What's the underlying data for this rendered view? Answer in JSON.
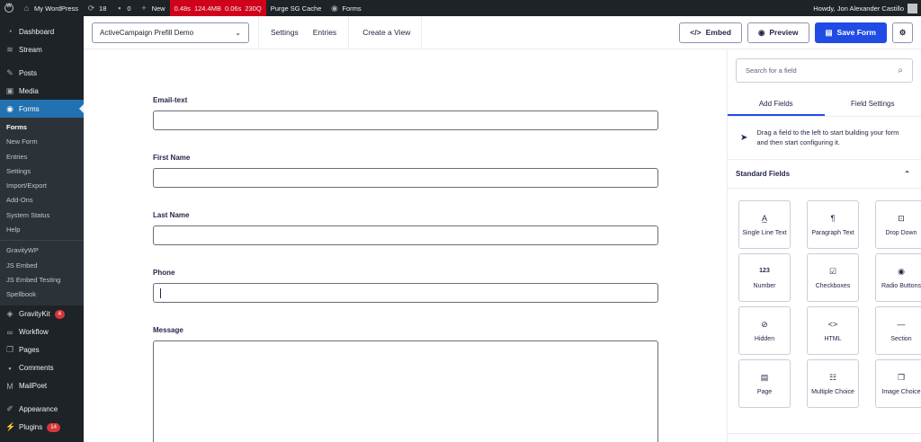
{
  "adminbar": {
    "site_name": "My WordPress",
    "updates_count": "18",
    "comments_count": "0",
    "new_label": "New",
    "perf": [
      "0.48s",
      "124.4MB",
      "0.06s",
      "230Q"
    ],
    "purge_label": "Purge SG Cache",
    "forms_label": "Forms",
    "howdy": "Howdy, Jon Alexander Castillo"
  },
  "sidebar": {
    "dashboard": "Dashboard",
    "stream": "Stream",
    "posts": "Posts",
    "media": "Media",
    "forms": "Forms",
    "submenu": [
      "Forms",
      "New Form",
      "Entries",
      "Settings",
      "Import/Export",
      "Add-Ons",
      "System Status",
      "Help"
    ],
    "submenu2": [
      "GravityWP",
      "JS Embed",
      "JS Embed Testing",
      "Spellbook"
    ],
    "gravitykit": "GravityKit",
    "gravitykit_badge": "4",
    "workflow": "Workflow",
    "pages": "Pages",
    "comments": "Comments",
    "mailpoet": "MailPoet",
    "appearance": "Appearance",
    "plugins": "Plugins",
    "plugins_badge": "14"
  },
  "toolbar": {
    "form_name": "ActiveCampaign Prefill Demo",
    "settings": "Settings",
    "entries": "Entries",
    "create_view": "Create a View",
    "embed": "Embed",
    "preview": "Preview",
    "save": "Save Form"
  },
  "form": {
    "fields": [
      {
        "label": "Email-text"
      },
      {
        "label": "First Name"
      },
      {
        "label": "Last Name"
      },
      {
        "label": "Phone"
      },
      {
        "label": "Message"
      }
    ]
  },
  "panel": {
    "search_placeholder": "Search for a field",
    "tab_add": "Add Fields",
    "tab_settings": "Field Settings",
    "hint": "Drag a field to the left to start building your form and then start configuring it.",
    "section": "Standard Fields",
    "field_types": [
      {
        "label": "Single Line Text",
        "icon": "text-icon"
      },
      {
        "label": "Paragraph Text",
        "icon": "paragraph-icon"
      },
      {
        "label": "Drop Down",
        "icon": "dropdown-icon"
      },
      {
        "label": "Number",
        "icon": "number-icon"
      },
      {
        "label": "Checkboxes",
        "icon": "checkbox-icon"
      },
      {
        "label": "Radio Buttons",
        "icon": "radio-icon"
      },
      {
        "label": "Hidden",
        "icon": "hidden-icon"
      },
      {
        "label": "HTML",
        "icon": "html-icon"
      },
      {
        "label": "Section",
        "icon": "section-icon"
      },
      {
        "label": "Page",
        "icon": "page-icon"
      },
      {
        "label": "Multiple Choice",
        "icon": "multiple-choice-icon"
      },
      {
        "label": "Image Choice",
        "icon": "image-choice-icon"
      }
    ]
  },
  "colors": {
    "admin_dark": "#1d2327",
    "active_blue": "#2271b1",
    "primary_blue": "#204ce5",
    "perf_red": "#d0021b"
  }
}
